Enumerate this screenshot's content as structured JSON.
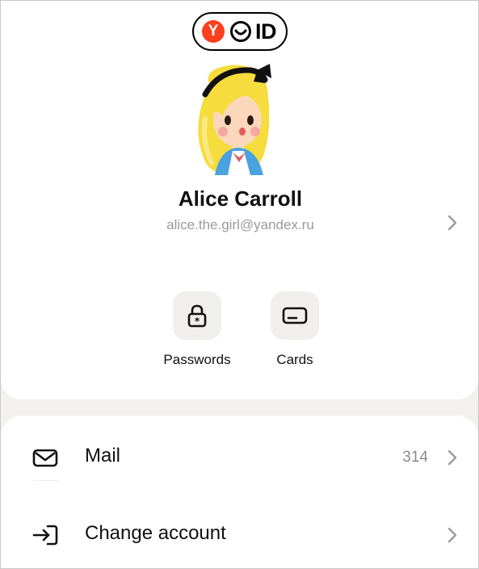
{
  "logo": {
    "letter": "Y",
    "text": "ID"
  },
  "user": {
    "name": "Alice Carroll",
    "email": "alice.the.girl@yandex.ru"
  },
  "quick_actions": [
    {
      "label": "Passwords",
      "icon": "lock-icon"
    },
    {
      "label": "Cards",
      "icon": "card-icon"
    }
  ],
  "menu": {
    "mail": {
      "label": "Mail",
      "count": "314",
      "icon": "envelope-icon"
    },
    "change_account": {
      "label": "Change account",
      "icon": "sign-in-icon"
    }
  },
  "colors": {
    "brand_red": "#fc3f1d",
    "background": "#f2f1ef",
    "card": "#ffffff",
    "muted_text": "#9a9a9a"
  }
}
